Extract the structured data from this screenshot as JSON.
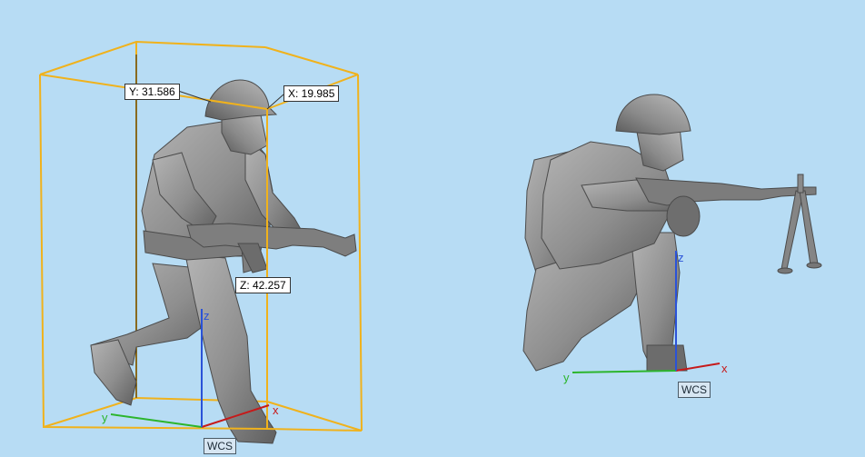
{
  "viewport": {
    "background_color": "#b7dcf4",
    "bbox_color": "#f0b21c",
    "model_color": "#8e8e8e"
  },
  "models": [
    {
      "name": "soldier-advancing-with-rifle"
    },
    {
      "name": "soldier-kneeling-with-machine-gun"
    }
  ],
  "dimensions": {
    "y": "Y: 31.586",
    "x": "X: 19.985",
    "z": "Z: 42.257"
  },
  "triad_left": {
    "x_letter": "x",
    "y_letter": "y",
    "z_letter": "z",
    "label": "WCS",
    "x_color": "#c61a1a",
    "y_color": "#2cb52c",
    "z_color": "#2a52d8"
  },
  "triad_right": {
    "x_letter": "x",
    "y_letter": "y",
    "z_letter": "z",
    "label": "WCS",
    "x_color": "#c61a1a",
    "y_color": "#2cb52c",
    "z_color": "#2a52d8"
  }
}
